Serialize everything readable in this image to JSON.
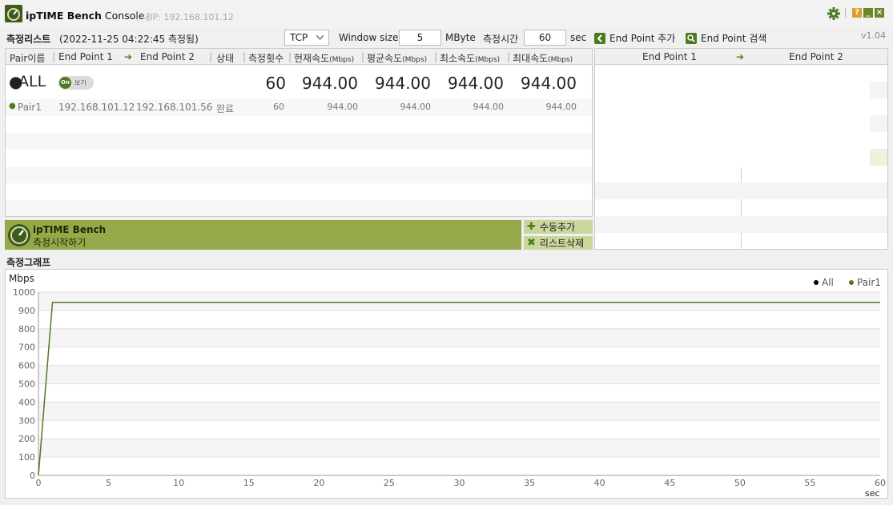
{
  "app": {
    "title_bold": "ipTIME Bench",
    "title_rest": " Console",
    "ip_info": "내IP: 192.168.101.12",
    "version": "v1.04"
  },
  "toolbar": {
    "list_title": "측정리스트",
    "measure_time_stamp": "(2022-11-25 04:22:45 측정됨)",
    "protocol": "TCP",
    "window_size_label": "Window size",
    "window_size_value": "5",
    "window_unit": "MByte",
    "duration_label": "측정시간",
    "duration_value": "60",
    "duration_unit": "sec",
    "add_endpoint": "End Point 추가",
    "search_endpoint": "End Point 검색"
  },
  "table": {
    "headers": [
      "Pair이름",
      "End Point 1",
      "End Point 2",
      "상태",
      "측정횟수",
      "현재속도",
      "평균속도",
      "최소속도",
      "최대속도"
    ],
    "unit": "(Mbps)",
    "all_row": {
      "name": "ALL",
      "toggle": "On",
      "view": "보기",
      "count": "60",
      "current": "944.00",
      "average": "944.00",
      "min": "944.00",
      "max": "944.00"
    },
    "pairs": [
      {
        "name": "Pair1",
        "ep1": "192.168.101.12",
        "ep2": "192.168.101.56",
        "status": "완료",
        "count": "60",
        "current": "944.00",
        "average": "944.00",
        "min": "944.00",
        "max": "944.00"
      }
    ]
  },
  "endpoints": {
    "ep1": "End Point 1",
    "ep2": "End Point 2"
  },
  "bench": {
    "title": "ipTIME Bench",
    "subtitle": "측정시작하기",
    "manual_add": "수동추가",
    "delete_list": "리스트삭제"
  },
  "graph": {
    "title": "측정그래프",
    "ylabel": "Mbps",
    "xlabel": "sec",
    "legend_all": "All",
    "legend_pair1": "Pair1"
  },
  "chart_data": {
    "type": "line",
    "title": "측정그래프",
    "ylabel": "Mbps",
    "xlabel": "sec",
    "ylim": [
      0,
      1000
    ],
    "xlim": [
      0,
      60
    ],
    "yticks": [
      0,
      100,
      200,
      300,
      400,
      500,
      600,
      700,
      800,
      900,
      1000
    ],
    "xticks": [
      0,
      5,
      10,
      15,
      20,
      25,
      30,
      35,
      40,
      45,
      50,
      55,
      60
    ],
    "series": [
      {
        "name": "Pair1",
        "color": "#4e7a1f",
        "points": [
          [
            0,
            0
          ],
          [
            1,
            944
          ],
          [
            60,
            944
          ]
        ]
      }
    ],
    "legend": [
      "All",
      "Pair1"
    ],
    "legend_colors": {
      "All": "#000000",
      "Pair1": "#4e7a1f"
    }
  },
  "colors": {
    "accent": "#4e7a1f",
    "bench_green": "#96a94a",
    "button_green": "#c9d69c"
  }
}
